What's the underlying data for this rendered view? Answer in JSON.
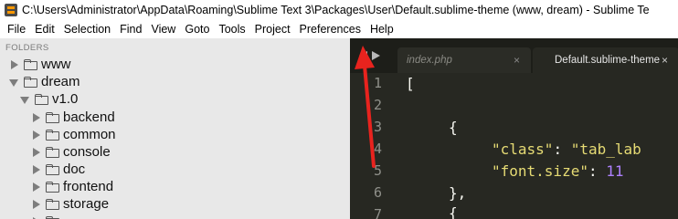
{
  "window": {
    "title": "C:\\Users\\Administrator\\AppData\\Roaming\\Sublime Text 3\\Packages\\User\\Default.sublime-theme (www, dream) - Sublime Te"
  },
  "menubar": {
    "items": [
      "File",
      "Edit",
      "Selection",
      "Find",
      "View",
      "Goto",
      "Tools",
      "Project",
      "Preferences",
      "Help"
    ]
  },
  "sidebar": {
    "header": "FOLDERS",
    "tree": [
      {
        "label": "www",
        "state": "closed",
        "level": 0
      },
      {
        "label": "dream",
        "state": "open",
        "level": 0
      },
      {
        "label": "v1.0",
        "state": "open",
        "level": 1
      },
      {
        "label": "backend",
        "state": "closed",
        "level": 2
      },
      {
        "label": "common",
        "state": "closed",
        "level": 2
      },
      {
        "label": "console",
        "state": "closed",
        "level": 2
      },
      {
        "label": "doc",
        "state": "closed",
        "level": 2
      },
      {
        "label": "frontend",
        "state": "closed",
        "level": 2
      },
      {
        "label": "storage",
        "state": "closed",
        "level": 2
      }
    ]
  },
  "editor": {
    "tabs": [
      {
        "label": "index.php",
        "active": false,
        "close": "×"
      },
      {
        "label": "Default.sublime-theme",
        "active": true,
        "close": "×"
      }
    ],
    "line_numbers": [
      "1",
      "2",
      "3",
      "4",
      "5",
      "6",
      "7"
    ],
    "lines": {
      "l1": "[",
      "l3": "{",
      "l4_key": "\"class\"",
      "l4_sep": ": ",
      "l4_val": "\"tab_lab",
      "l5_key": "\"font.size\"",
      "l5_sep": ": ",
      "l5_val": "11",
      "l6": "},",
      "l7": "{"
    }
  },
  "colors": {
    "editor_bg": "#272822",
    "string": "#e6db74",
    "number": "#ae81ff",
    "annotation_arrow": "#e8231e"
  },
  "icons": {
    "app": "sublime-text-icon",
    "folder": "folder-icon",
    "nav": "tab-navigation-arrows-icon"
  }
}
